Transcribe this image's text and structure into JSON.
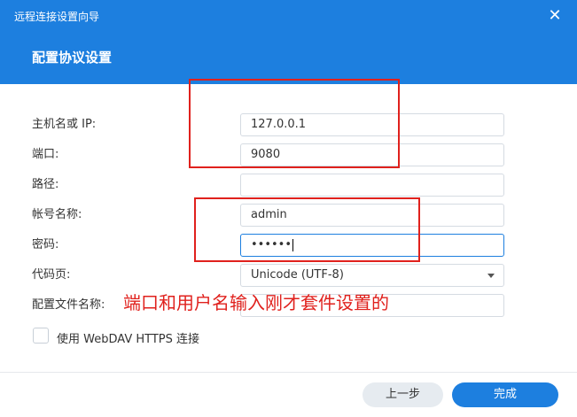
{
  "window": {
    "title": "远程连接设置向导",
    "close_icon": "close-icon"
  },
  "page": {
    "title": "配置协议设置"
  },
  "form": {
    "host_label": "主机名或 IP:",
    "host_value": "127.0.0.1",
    "port_label": "端口:",
    "port_value": "9080",
    "path_label": "路径:",
    "path_value": "",
    "account_label": "帐号名称:",
    "account_value": "admin",
    "password_label": "密码:",
    "password_mask": "••••••",
    "codepage_label": "代码页:",
    "codepage_value": "Unicode (UTF-8)",
    "config_name_label": "配置文件名称:",
    "config_name_value": "",
    "https_checkbox_label": "使用 WebDAV HTTPS 连接",
    "https_checked": false
  },
  "annotation": {
    "text": "端口和用户名输入刚才套件设置的",
    "color": "#e0211d"
  },
  "footer": {
    "prev_label": "上一步",
    "done_label": "完成"
  },
  "colors": {
    "accent": "#1d7fdf",
    "annotation": "#e0211d"
  }
}
